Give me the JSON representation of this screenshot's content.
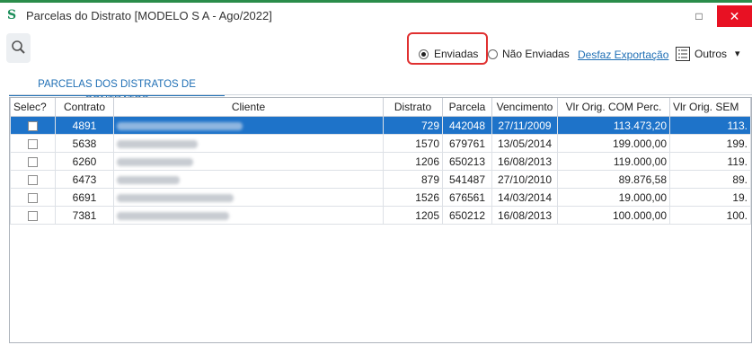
{
  "window": {
    "title": "Parcelas do Distrato [MODELO S A - Ago/2022]",
    "app_icon": "s-logo-icon",
    "maximize_glyph": "□",
    "close_glyph": "✕"
  },
  "toolbar": {
    "search_icon": "search-icon",
    "radio_sent_label": "Enviadas",
    "radio_not_sent_label": "Não Enviadas",
    "undo_export_label": "Desfaz Exportação",
    "others_label": "Outros",
    "others_arrow": "▾",
    "selected_radio": "Enviadas"
  },
  "tabs": [
    {
      "label": "PARCELAS DOS DISTRATOS DE CONTRATOS",
      "active": true
    }
  ],
  "grid": {
    "headers": {
      "select": "Selec?",
      "contract": "Contrato",
      "client": "Cliente",
      "distrato": "Distrato",
      "installment": "Parcela",
      "due_date": "Vencimento",
      "value_with": "Vlr Orig. COM Perc.",
      "value_without": "Vlr Orig. SEM"
    },
    "rows": [
      {
        "contract": "4891",
        "distrato": "729",
        "installment": "442048",
        "due_date": "27/11/2009",
        "value_with": "113.473,20",
        "value_without": "113.",
        "selected": true
      },
      {
        "contract": "5638",
        "distrato": "1570",
        "installment": "679761",
        "due_date": "13/05/2014",
        "value_with": "199.000,00",
        "value_without": "199.",
        "selected": false
      },
      {
        "contract": "6260",
        "distrato": "1206",
        "installment": "650213",
        "due_date": "16/08/2013",
        "value_with": "119.000,00",
        "value_without": "119.",
        "selected": false
      },
      {
        "contract": "6473",
        "distrato": "879",
        "installment": "541487",
        "due_date": "27/10/2010",
        "value_with": "89.876,58",
        "value_without": "89.",
        "selected": false
      },
      {
        "contract": "6691",
        "distrato": "1526",
        "installment": "676561",
        "due_date": "14/03/2014",
        "value_with": "19.000,00",
        "value_without": "19.",
        "selected": false
      },
      {
        "contract": "7381",
        "distrato": "1205",
        "installment": "650212",
        "due_date": "16/08/2013",
        "value_with": "100.000,00",
        "value_without": "100.",
        "selected": false
      }
    ]
  },
  "colors": {
    "accent": "#1f6fb5",
    "selection": "#1e73c9",
    "highlight_border": "#e03030",
    "close_button": "#e81123"
  }
}
